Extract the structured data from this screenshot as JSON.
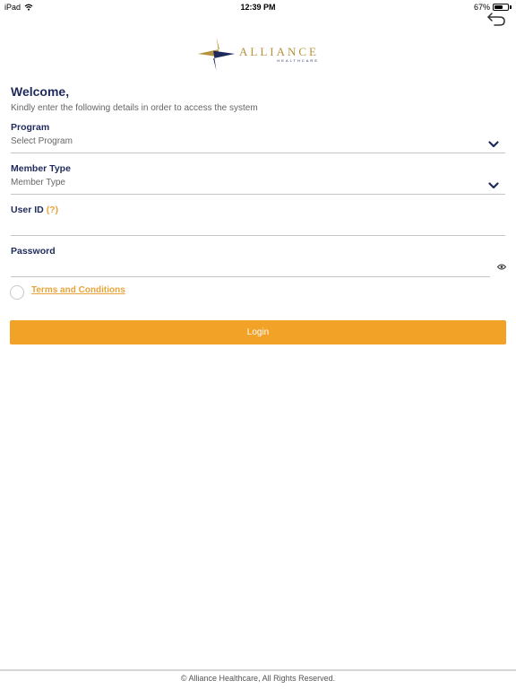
{
  "status_bar": {
    "device": "iPad",
    "time": "12:39 PM",
    "battery": "67%",
    "battery_level": 0.67
  },
  "logo": {
    "name": "ALLIANCE",
    "tagline": "HEALTHCARE",
    "trademark": "™"
  },
  "header": {
    "welcome": "Welcome,",
    "subtitle": "Kindly enter the following details in order to access the system"
  },
  "form": {
    "program": {
      "label": "Program",
      "value": "Select Program"
    },
    "member_type": {
      "label": "Member Type",
      "value": "Member Type"
    },
    "user_id": {
      "label": "User ID",
      "help": "(?)",
      "value": ""
    },
    "password": {
      "label": "Password",
      "value": ""
    }
  },
  "terms": {
    "label": "Terms and Conditions"
  },
  "login": {
    "label": "Login"
  },
  "footer": {
    "text": "© Alliance Healthcare, All Rights Reserved."
  },
  "colors": {
    "navy": "#1f2a5c",
    "gold": "#b5923d",
    "accent": "#f2a226"
  },
  "icons": [
    "wifi-icon",
    "battery-icon",
    "back-arrow-icon",
    "chevron-down-icon",
    "eye-icon"
  ]
}
